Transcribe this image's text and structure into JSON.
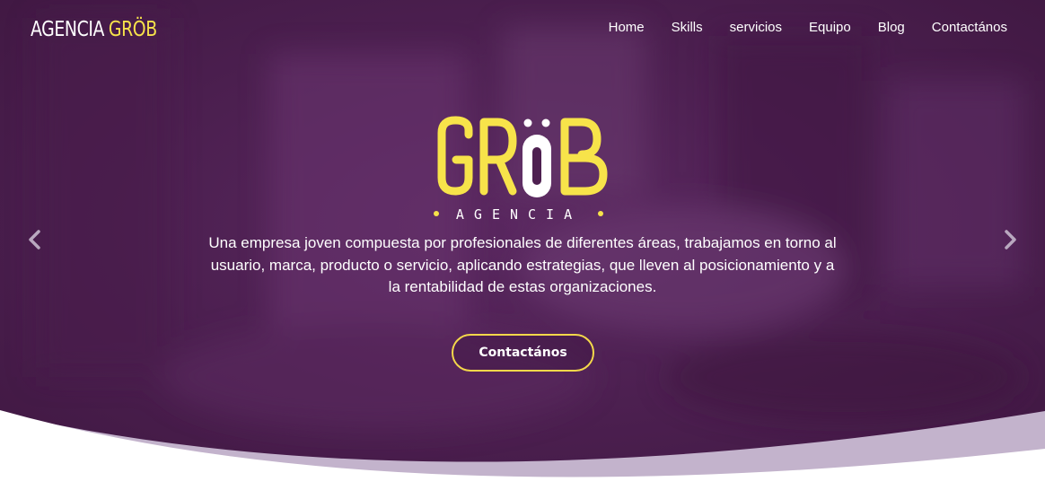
{
  "brand": {
    "part1": "AGENCIA",
    "part2": "GRÖB"
  },
  "nav": {
    "items": [
      {
        "label": "Home"
      },
      {
        "label": "Skills"
      },
      {
        "label": "servicios"
      },
      {
        "label": "Equipo"
      },
      {
        "label": "Blog"
      },
      {
        "label": "Contactános"
      }
    ]
  },
  "hero": {
    "logo_word": "GRÖB",
    "logo_subtitle": "AGENCIA",
    "tagline": "Una empresa joven compuesta por profesionales de diferentes áreas, trabajamos en torno al usuario, marca, producto o servicio, aplicando estrategias, que lleven al posicionamiento y a la rentabilidad de estas organizaciones.",
    "cta_label": "Contactános"
  },
  "carousel": {
    "prev_icon": "chevron-left-icon",
    "next_icon": "chevron-right-icon"
  },
  "colors": {
    "overlay": "#4e2050",
    "accent_yellow": "#f7e34a",
    "wave_lilac": "#c3b3cc",
    "text": "#ffffff"
  }
}
